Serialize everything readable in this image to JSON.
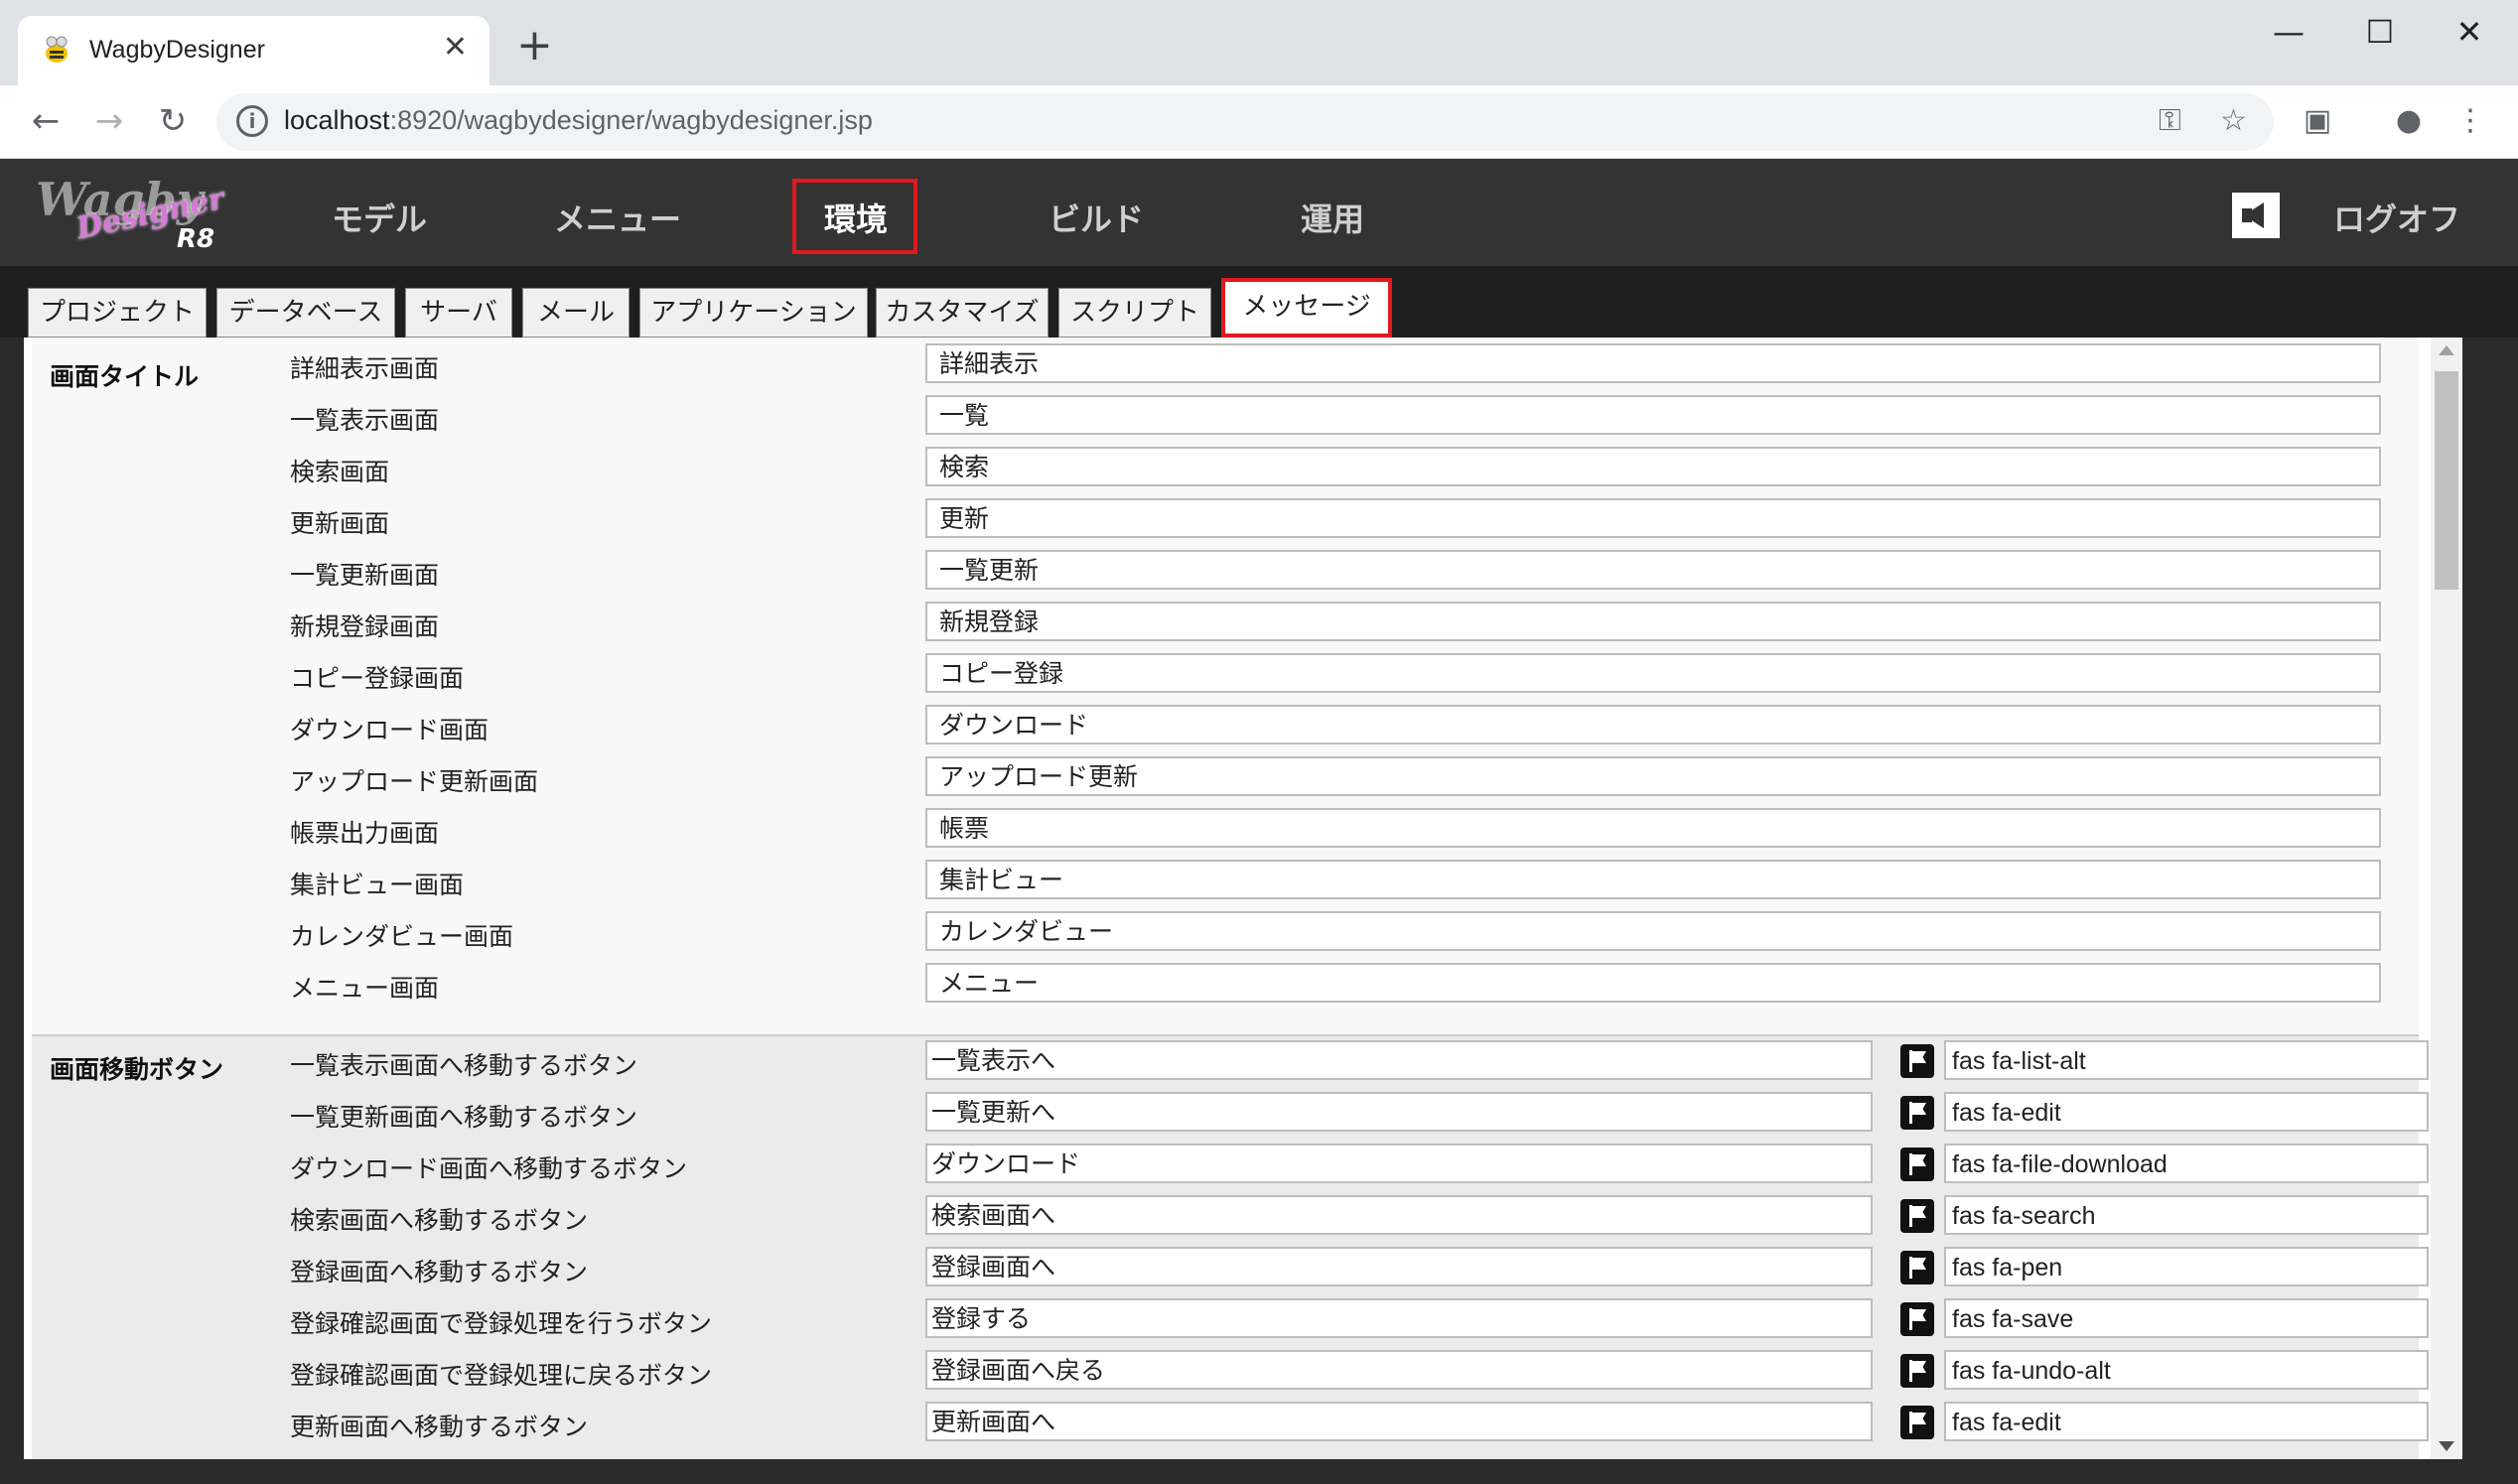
{
  "browser": {
    "tab_title": "WagbyDesigner",
    "url_host": "localhost",
    "url_rest": ":8920/wagbydesigner/wagbydesigner.jsp"
  },
  "app": {
    "logo_text": "Wagby",
    "logo_script": "Designer",
    "logo_version": "R8",
    "nav": [
      "モデル",
      "メニュー",
      "環境",
      "ビルド",
      "運用"
    ],
    "active_nav": "環境",
    "logoff": "ログオフ"
  },
  "subtabs": [
    "プロジェクト",
    "データベース",
    "サーバ",
    "メール",
    "アプリケーション",
    "カスタマイズ",
    "スクリプト",
    "メッセージ"
  ],
  "active_subtab": "メッセージ",
  "screen_titles": {
    "title": "画面タイトル",
    "rows": [
      {
        "label": "詳細表示画面",
        "value": "詳細表示"
      },
      {
        "label": "一覧表示画面",
        "value": "一覧"
      },
      {
        "label": "検索画面",
        "value": "検索"
      },
      {
        "label": "更新画面",
        "value": "更新"
      },
      {
        "label": "一覧更新画面",
        "value": "一覧更新"
      },
      {
        "label": "新規登録画面",
        "value": "新規登録"
      },
      {
        "label": "コピー登録画面",
        "value": "コピー登録"
      },
      {
        "label": "ダウンロード画面",
        "value": "ダウンロード"
      },
      {
        "label": "アップロード更新画面",
        "value": "アップロード更新"
      },
      {
        "label": "帳票出力画面",
        "value": "帳票"
      },
      {
        "label": "集計ビュー画面",
        "value": "集計ビュー"
      },
      {
        "label": "カレンダビュー画面",
        "value": "カレンダビュー"
      },
      {
        "label": "メニュー画面",
        "value": "メニュー"
      }
    ]
  },
  "nav_buttons": {
    "title": "画面移動ボタン",
    "rows": [
      {
        "label": "一覧表示画面へ移動するボタン",
        "value": "一覧表示へ",
        "icon": "fas fa-list-alt"
      },
      {
        "label": "一覧更新画面へ移動するボタン",
        "value": "一覧更新へ",
        "icon": "fas fa-edit"
      },
      {
        "label": "ダウンロード画面へ移動するボタン",
        "value": "ダウンロード",
        "icon": "fas fa-file-download"
      },
      {
        "label": "検索画面へ移動するボタン",
        "value": "検索画面へ",
        "icon": "fas fa-search"
      },
      {
        "label": "登録画面へ移動するボタン",
        "value": "登録画面へ",
        "icon": "fas fa-pen"
      },
      {
        "label": "登録確認画面で登録処理を行うボタン",
        "value": "登録する",
        "icon": "fas fa-save"
      },
      {
        "label": "登録確認画面で登録処理に戻るボタン",
        "value": "登録画面へ戻る",
        "icon": "fas fa-undo-alt"
      },
      {
        "label": "更新画面へ移動するボタン",
        "value": "更新画面へ",
        "icon": "fas fa-edit"
      }
    ]
  },
  "colors": {
    "highlight": "#e0191e",
    "header_bg": "#333333"
  }
}
